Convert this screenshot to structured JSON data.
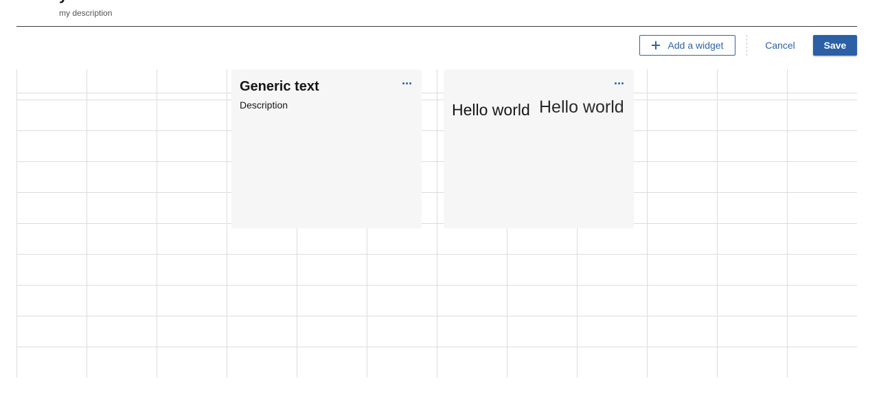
{
  "header": {
    "title_fragment": "y",
    "description": "my description"
  },
  "toolbar": {
    "add_widget_label": "Add a widget",
    "cancel_label": "Cancel",
    "save_label": "Save"
  },
  "widgets": [
    {
      "title": "Generic text",
      "description": "Description",
      "menu_icon": "more-horizontal-icon"
    },
    {
      "text_primary": "Hello world",
      "text_secondary": "Hello world",
      "menu_icon": "more-horizontal-icon"
    }
  ],
  "colors": {
    "accent": "#2d62a7",
    "widget_bg": "#f6f6f6",
    "grid_line": "#dcdcdc"
  }
}
